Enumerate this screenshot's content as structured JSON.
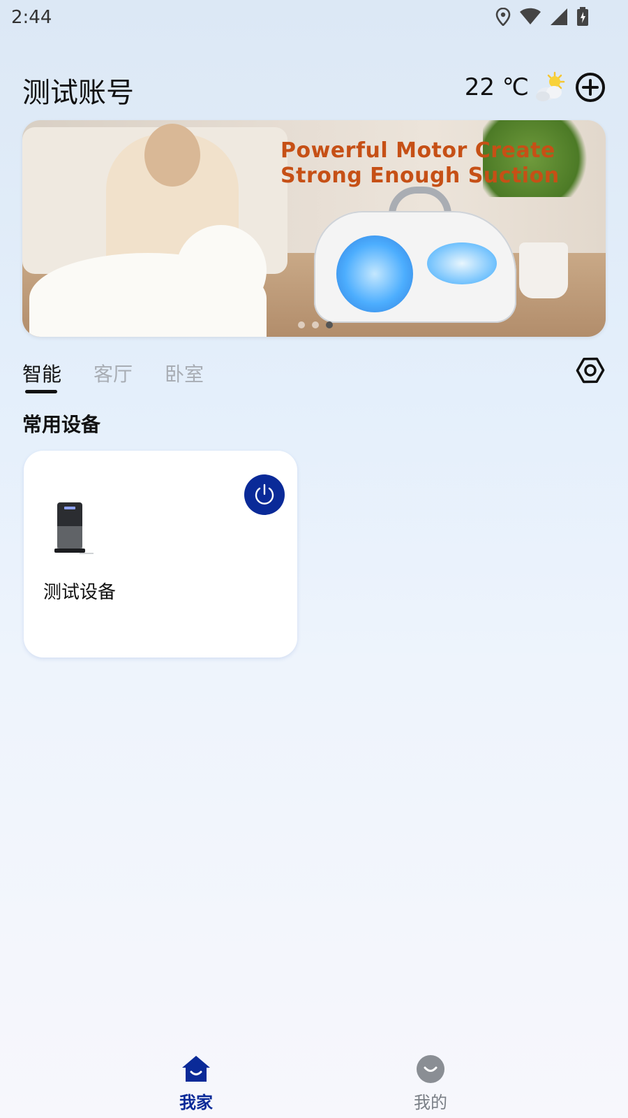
{
  "status_bar": {
    "time": "2:44",
    "icons": [
      "location-icon",
      "wifi-icon",
      "signal-icon",
      "battery-icon"
    ]
  },
  "header": {
    "account_name": "测试账号",
    "temperature": "22 ℃",
    "weather_icon": "partly-cloudy-sun-icon",
    "add_icon": "plus-circle-icon"
  },
  "banner": {
    "title_line1": "Powerful Motor Create",
    "title_line2": "Strong Enough Suction",
    "slide_count": 3,
    "active_slide": 3
  },
  "tabs": [
    {
      "label": "智能",
      "active": true
    },
    {
      "label": "客厅",
      "active": false
    },
    {
      "label": "卧室",
      "active": false
    }
  ],
  "settings_icon": "hexagon-settings-icon",
  "section_title": "常用设备",
  "devices": [
    {
      "name": "测试设备",
      "power_icon": "power-icon"
    }
  ],
  "bottom_nav": {
    "items": [
      {
        "label": "我家",
        "icon": "home-icon",
        "active": true
      },
      {
        "label": "我的",
        "icon": "profile-icon",
        "active": false
      }
    ]
  },
  "colors": {
    "accent": "#0a2a98",
    "banner_text": "#c65016",
    "inactive_tab": "#a8adb4"
  }
}
